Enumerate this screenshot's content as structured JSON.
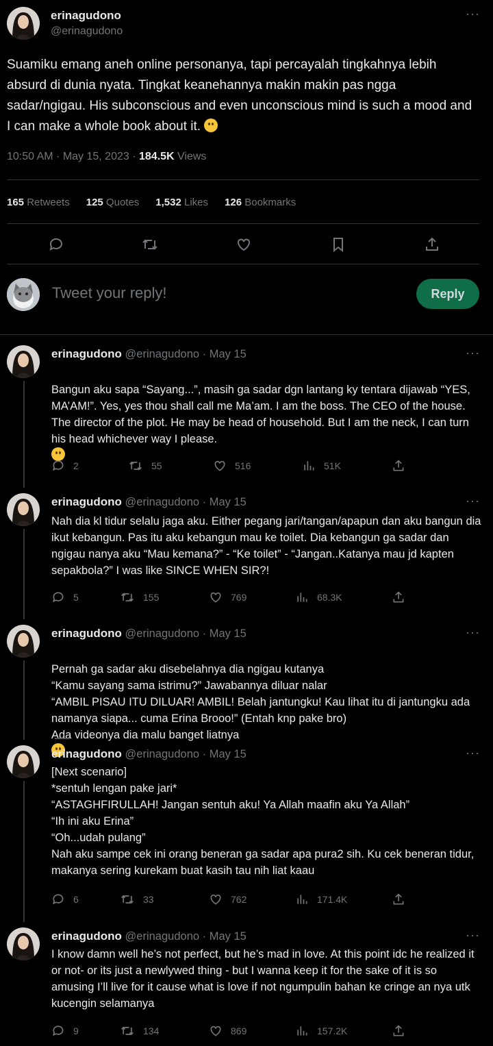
{
  "main_tweet": {
    "display_name": "erinagudono",
    "handle": "@erinagudono",
    "text": "Suamiku emang aneh online personanya, tapi percayalah tingkahnya lebih absurd di dunia nyata. Tingkat keanehannya makin makin pas ngga sadar/ngigau. His subconscious and even unconscious mind is such a mood and I can make a whole book about it.",
    "emoji": "slightly-smiling-face",
    "time": "10:50 AM · May 15, 2023 · ",
    "views_count": "184.5K",
    "views_label": " Views",
    "stats": [
      {
        "count": "165",
        "label": " Retweets"
      },
      {
        "count": "125",
        "label": " Quotes"
      },
      {
        "count": "1,532",
        "label": " Likes"
      },
      {
        "count": "126",
        "label": " Bookmarks"
      }
    ]
  },
  "reply_box": {
    "placeholder": "Tweet your reply!",
    "button": "Reply"
  },
  "replies": [
    {
      "display_name": "erinagudono",
      "meta": "@erinagudono · May 15",
      "text": "Bangun aku sapa “Sayang...”, masih ga sadar dgn lantang ky tentara dijawab “YES, MA’AM!”. Yes, yes thou shall call me Ma’am. I am the boss. The CEO of the house. The director of the plot. He may be head of household. But I am the neck, I can turn his head whichever way I please.",
      "reply_count": "2",
      "retweet_count": "55",
      "like_count": "516",
      "view_count": "51K"
    },
    {
      "display_name": "erinagudono",
      "meta": "@erinagudono · May 15",
      "text": "Nah dia kl tidur selalu jaga aku. Either pegang jari/tangan/apapun dan aku bangun dia ikut kebangun. Pas itu aku kebangun mau ke toilet. Dia kebangun ga sadar dan ngigau nanya aku “Mau kemana?” - “Ke toilet” - “Jangan..Katanya mau jd kapten sepakbola?” I was like SINCE WHEN SIR?!",
      "reply_count": "5",
      "retweet_count": "155",
      "like_count": "769",
      "view_count": "68.3K"
    },
    {
      "display_name": "erinagudono",
      "meta": "@erinagudono · May 15",
      "text": "Pernah ga sadar aku disebelahnya dia ngigau kutanya\n“Kamu sayang sama istrimu?” Jawabannya diluar nalar\n“AMBIL PISAU ITU DILUAR! AMBIL! Belah jantungku! Kau lihat itu di jantungku ada namanya siapa... cuma Erina Brooo!” (Entah knp pake bro)\nAda videonya dia malu banget liatnya",
      "emoji": "face-with-tears-of-joy"
    },
    {
      "display_name": "erinagudono",
      "meta": "@erinagudono · May 15",
      "text": "[Next scenario]\n*sentuh lengan pake jari*\n“ASTAGHFIRULLAH! Jangan sentuh aku! Ya Allah maafin aku Ya Allah”\n“Ih ini aku Erina”\n“Oh...udah pulang”\nNah aku sampe cek ini orang beneran ga sadar apa pura2 sih. Ku cek beneran tidur, makanya sering kurekam buat kasih tau nih liat kaau",
      "reply_count": "6",
      "retweet_count": "33",
      "like_count": "762",
      "view_count": "171.4K"
    },
    {
      "display_name": "erinagudono",
      "meta": "@erinagudono · May 15",
      "text": "I know damn well he’s not perfect, but he’s mad in love. At this point idc he realized it or not- or its just a newlywed thing - but I wanna keep it for the sake of it is so amusing I’ll live for it cause what is love if not ngumpulin bahan ke cringe an nya utk kucengin selamanya",
      "reply_count": "9",
      "retweet_count": "134",
      "like_count": "869",
      "view_count": "157.2K"
    }
  ],
  "more_label": "···",
  "colors": {
    "accent_button": "#0f6e48",
    "muted": "#71767b",
    "background": "#000000"
  }
}
